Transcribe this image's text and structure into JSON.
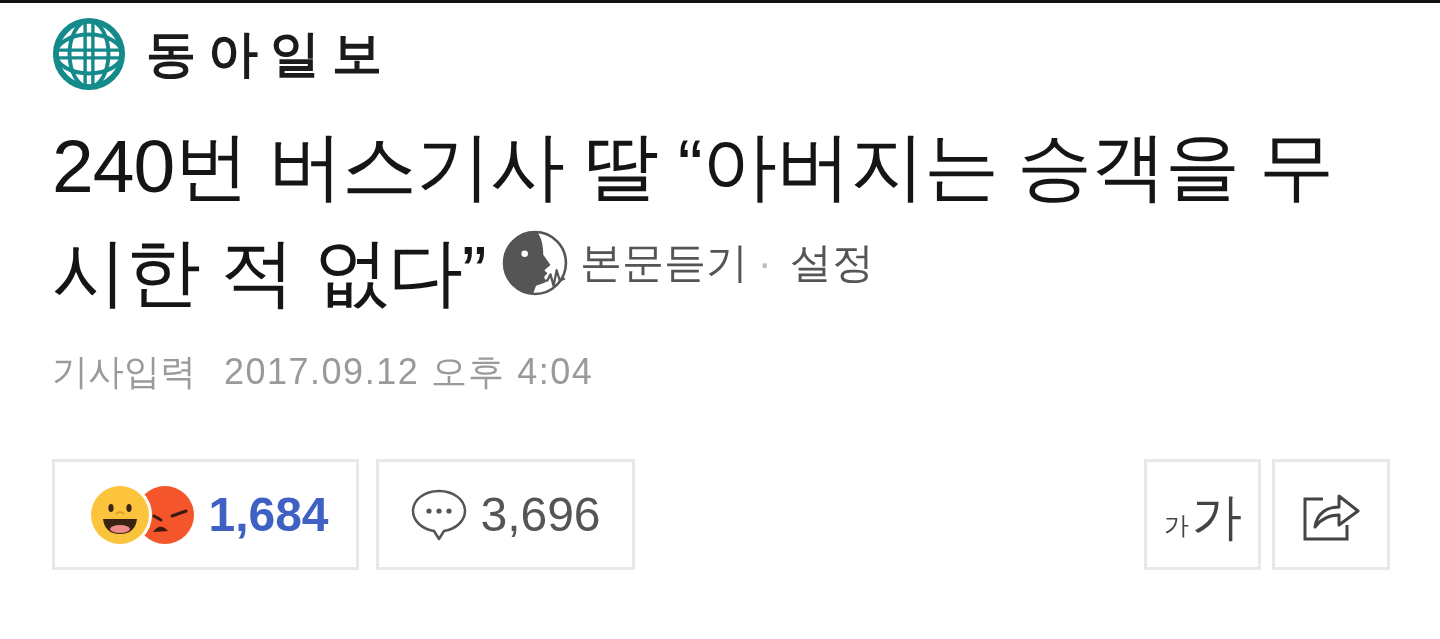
{
  "masthead": {
    "logo_text": "동아일보"
  },
  "headline": {
    "lines": [
      "240번 버스기사 딸 “아버지는 승객을 무",
      "시한 적 없다”"
    ],
    "listen_label": "본문듣기",
    "separator": "·",
    "settings_label": "설정"
  },
  "byline": {
    "label": "기사입력",
    "published": "2017.09.12 오후 4:04"
  },
  "actions": {
    "reactions": {
      "emojis": [
        {
          "kind": "happy"
        },
        {
          "kind": "angry"
        }
      ],
      "count": "1,684"
    },
    "comments": {
      "count": "3,696"
    },
    "text_size": {
      "small": "가",
      "large": "가"
    }
  }
}
